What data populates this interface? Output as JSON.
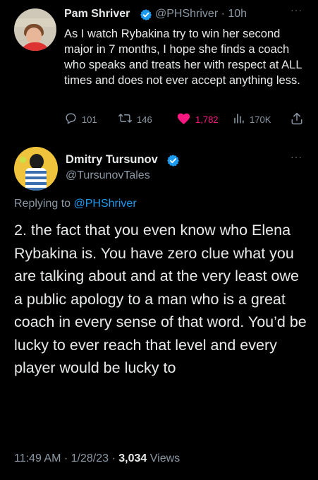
{
  "parent_tweet": {
    "author_name": "Pam Shriver",
    "handle": "@PHShriver",
    "time": "10h",
    "more_label": "···",
    "text": "As I watch Rybakina try to win her second major in 7 months, I hope she finds a coach who speaks and treats her with respect at ALL times and does not ever accept anything less.",
    "replies": "101",
    "retweets": "146",
    "likes": "1,782",
    "views": "170K"
  },
  "main_tweet": {
    "author_name": "Dmitry Tursunov",
    "handle": "@TursunovTales",
    "more_label": "···",
    "replying_prefix": "Replying to",
    "replying_to": "@PHShriver",
    "text": "2. the fact that you even know who Elena Rybakina is. You have zero clue what you are talking about and at the very least owe a public apology to a man who is a great coach in every sense of that word. You’d be lucky to ever reach that level and every player would be lucky to",
    "time": "11:49 AM",
    "date": "1/28/23",
    "views_count": "3,034",
    "views_label": "Views"
  },
  "colors": {
    "background": "#000000",
    "text": "#e7e9ea",
    "secondary_text": "#8b98a5",
    "accent": "#1d9bf0",
    "like": "#f91880"
  },
  "icons": [
    "verified-badge-icon",
    "reply-icon",
    "retweet-icon",
    "like-icon",
    "views-icon",
    "share-icon",
    "more-icon"
  ]
}
